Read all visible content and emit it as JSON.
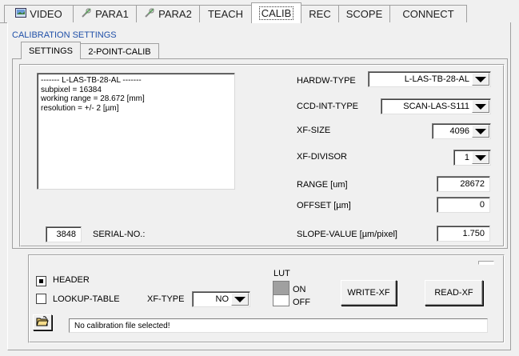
{
  "tabs": [
    {
      "label": "VIDEO",
      "icon": "video-icon"
    },
    {
      "label": "PARA1",
      "icon": "tools-icon"
    },
    {
      "label": "PARA2",
      "icon": "tools-icon"
    },
    {
      "label": "TEACH"
    },
    {
      "label": "CALIB",
      "active": true
    },
    {
      "label": "REC"
    },
    {
      "label": "SCOPE"
    },
    {
      "label": "CONNECT"
    }
  ],
  "section_title": "CALIBRATION SETTINGS",
  "subtabs": [
    "SETTINGS",
    "2-POINT-CALIB"
  ],
  "info_lines": [
    "------- L-LAS-TB-28-AL -------",
    "subpixel = 16384",
    "working range = 28.672 [mm]",
    "resolution = +/- 2 [µm]"
  ],
  "serial": {
    "value": "3848",
    "label": "SERIAL-NO.:"
  },
  "settings": {
    "hardw_type": {
      "label": "HARDW-TYPE",
      "value": "L-LAS-TB-28-AL"
    },
    "ccd_int_type": {
      "label": "CCD-INT-TYPE",
      "value": "SCAN-LAS-S111"
    },
    "xf_size": {
      "label": "XF-SIZE",
      "value": "4096"
    },
    "xf_divisor": {
      "label": "XF-DIVISOR",
      "value": "1"
    },
    "range": {
      "label": "RANGE [um]",
      "value": "28672"
    },
    "offset": {
      "label": "OFFSET [µm]",
      "value": "0"
    },
    "slope": {
      "label": "SLOPE-VALUE [µm/pixel]",
      "value": "1.750"
    }
  },
  "bottom": {
    "header_label": "HEADER",
    "header_checked": true,
    "lookup_label": "LOOKUP-TABLE",
    "lookup_checked": false,
    "xf_type_label": "XF-TYPE",
    "xf_type_value": "NO",
    "lut_label": "LUT",
    "lut_on": "ON",
    "lut_off": "OFF",
    "write_xf": "WRITE-XF",
    "read_xf": "READ-XF",
    "status": "No calibration file selected!"
  },
  "colors": {
    "accent_text": "#1f4fa8",
    "background": "#f0f0f0"
  }
}
